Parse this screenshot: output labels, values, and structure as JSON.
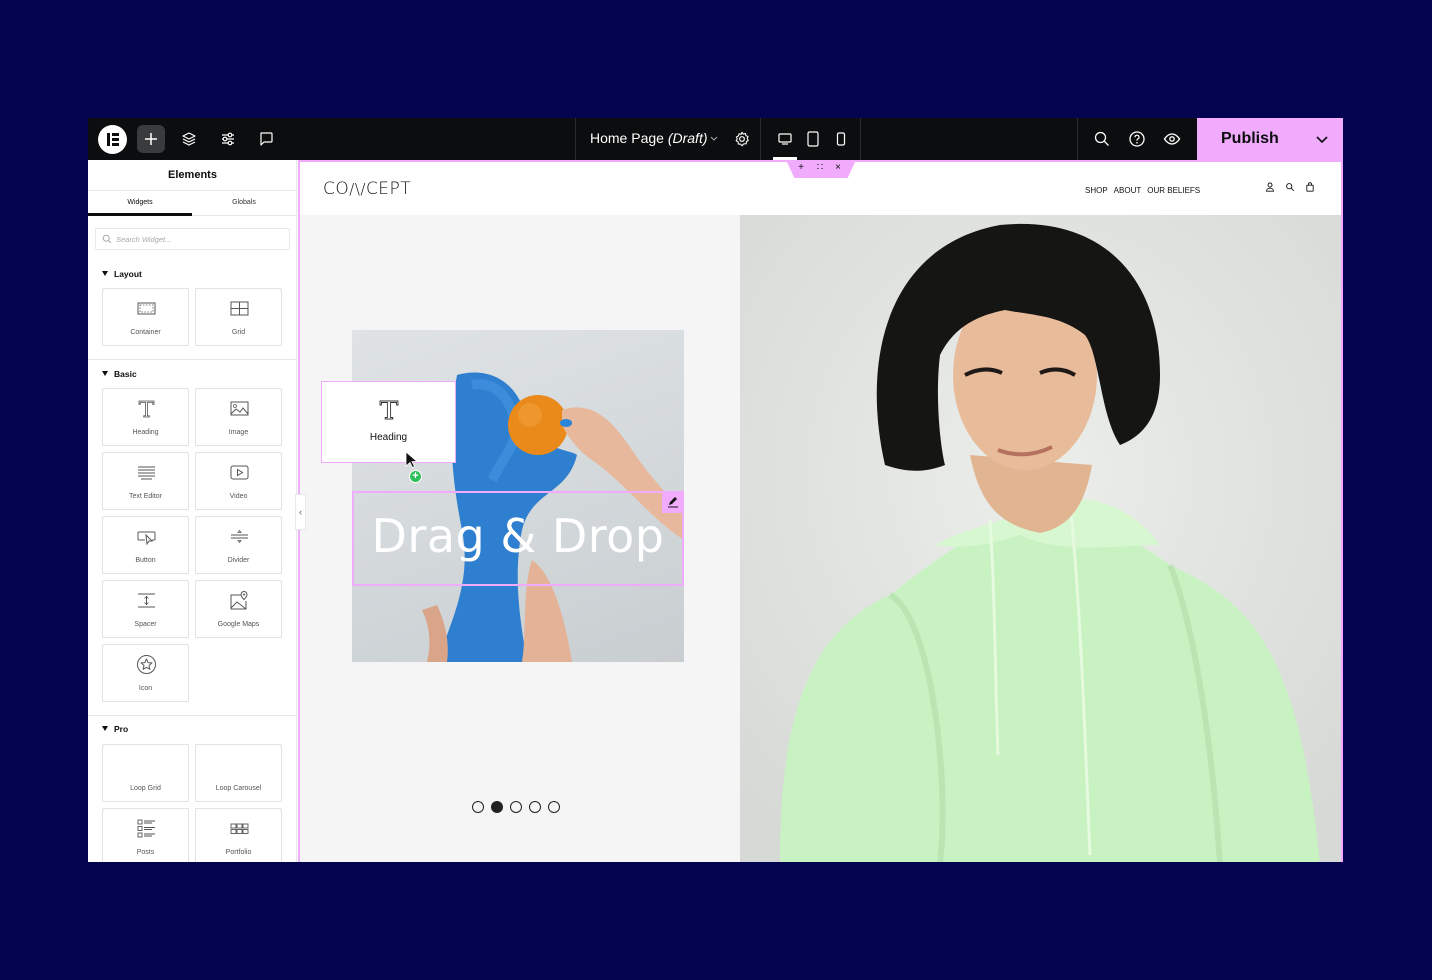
{
  "topbar": {
    "logo": "elementor-logo",
    "left_icons": [
      {
        "name": "add-element",
        "icon": "plus-icon"
      },
      {
        "name": "structure",
        "icon": "layers-icon"
      },
      {
        "name": "site-settings",
        "icon": "sliders-icon"
      },
      {
        "name": "notes",
        "icon": "comment-icon"
      }
    ],
    "page_title": "Home Page",
    "page_status": "(Draft)",
    "devices": [
      "desktop",
      "tablet",
      "mobile"
    ],
    "active_device": "desktop",
    "right_icons": [
      "search-icon",
      "help-icon",
      "preview-icon"
    ],
    "publish_label": "Publish",
    "accent_color": "#f0abfc"
  },
  "panel": {
    "title": "Elements",
    "tabs": [
      {
        "label": "Widgets",
        "active": true
      },
      {
        "label": "Globals",
        "active": false
      }
    ],
    "search_placeholder": "Search Widget...",
    "categories": [
      {
        "label": "Layout",
        "widgets": [
          "Container",
          "Grid"
        ]
      },
      {
        "label": "Basic",
        "widgets": [
          "Heading",
          "Image",
          "Text Editor",
          "Video",
          "Button",
          "Divider",
          "Spacer",
          "Google Maps",
          "Icon"
        ]
      },
      {
        "label": "Pro",
        "widgets": [
          "Loop Grid",
          "Loop Carousel",
          "Posts",
          "Portfolio"
        ]
      }
    ]
  },
  "canvas": {
    "site_logo": "CO/\\/CEPT",
    "nav": [
      "SHOP",
      "ABOUT",
      "OUR BELIEFS"
    ],
    "header_icons": [
      "user-icon",
      "search-icon",
      "bag-icon"
    ],
    "section_handle": {
      "add": "+",
      "drag": "∷",
      "close": "×"
    },
    "dragged_widget_label": "Heading",
    "heading_text": "Drag & Drop",
    "carousel": {
      "count": 5,
      "active_index": 1
    },
    "collapse_label": "‹"
  }
}
